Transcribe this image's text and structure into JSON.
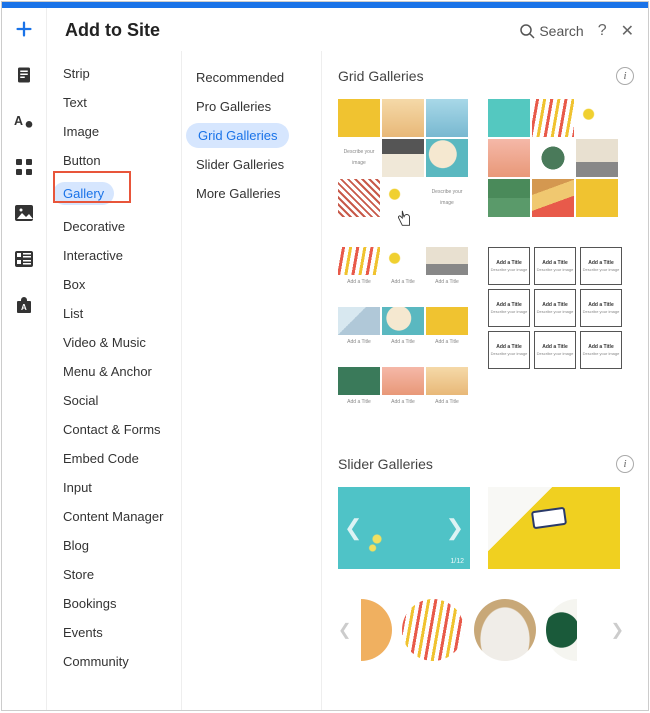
{
  "header": {
    "title": "Add to Site",
    "search_label": "Search",
    "help": "?",
    "close": "✕"
  },
  "rail": {
    "icons": [
      "plus-icon",
      "page-icon",
      "theme-icon",
      "apps-icon",
      "media-icon",
      "data-icon",
      "market-icon"
    ]
  },
  "categories": {
    "items": [
      "Strip",
      "Text",
      "Image",
      "Button",
      "Gallery",
      "Decorative",
      "Interactive",
      "Box",
      "List",
      "Video & Music",
      "Menu & Anchor",
      "Social",
      "Contact & Forms",
      "Embed Code",
      "Input",
      "Content Manager",
      "Blog",
      "Store",
      "Bookings",
      "Events",
      "Community"
    ],
    "selected_index": 4
  },
  "subcategories": {
    "items": [
      "Recommended",
      "Pro Galleries",
      "Grid Galleries",
      "Slider Galleries",
      "More Galleries"
    ],
    "selected_index": 2
  },
  "sections": {
    "grid": {
      "title": "Grid Galleries",
      "info": "i"
    },
    "slider": {
      "title": "Slider Galleries",
      "info": "i",
      "counter": "1/12"
    }
  },
  "placeholder": {
    "add_title": "Add a Title",
    "describe": "Describe your image"
  }
}
